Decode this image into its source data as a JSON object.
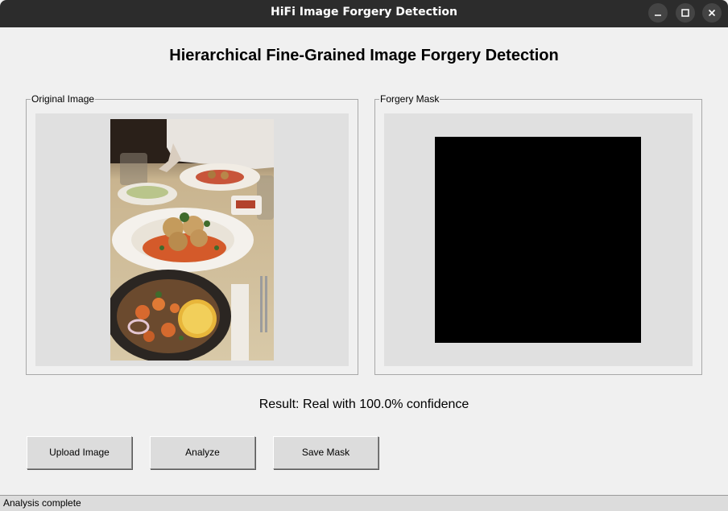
{
  "window": {
    "title": "HiFi Image Forgery Detection",
    "controls": [
      "minimize-icon",
      "maximize-icon",
      "close-icon"
    ]
  },
  "main": {
    "heading": "Hierarchical Fine-Grained Image Forgery Detection",
    "original_panel": {
      "label": "Original Image",
      "image": "photo of plated dishes on a dining table"
    },
    "mask_panel": {
      "label": "Forgery Mask",
      "mask_color": "#000000"
    },
    "result_text": "Result: Real with 100.0% confidence"
  },
  "buttons": {
    "upload": "Upload Image",
    "analyze": "Analyze",
    "save_mask": "Save Mask"
  },
  "status": {
    "text": "Analysis complete"
  },
  "colors": {
    "titlebar": "#2c2c2c",
    "window_bg": "#f0f0f0",
    "canvas_bg": "#e0e0e0",
    "button_bg": "#dcdcdc"
  }
}
